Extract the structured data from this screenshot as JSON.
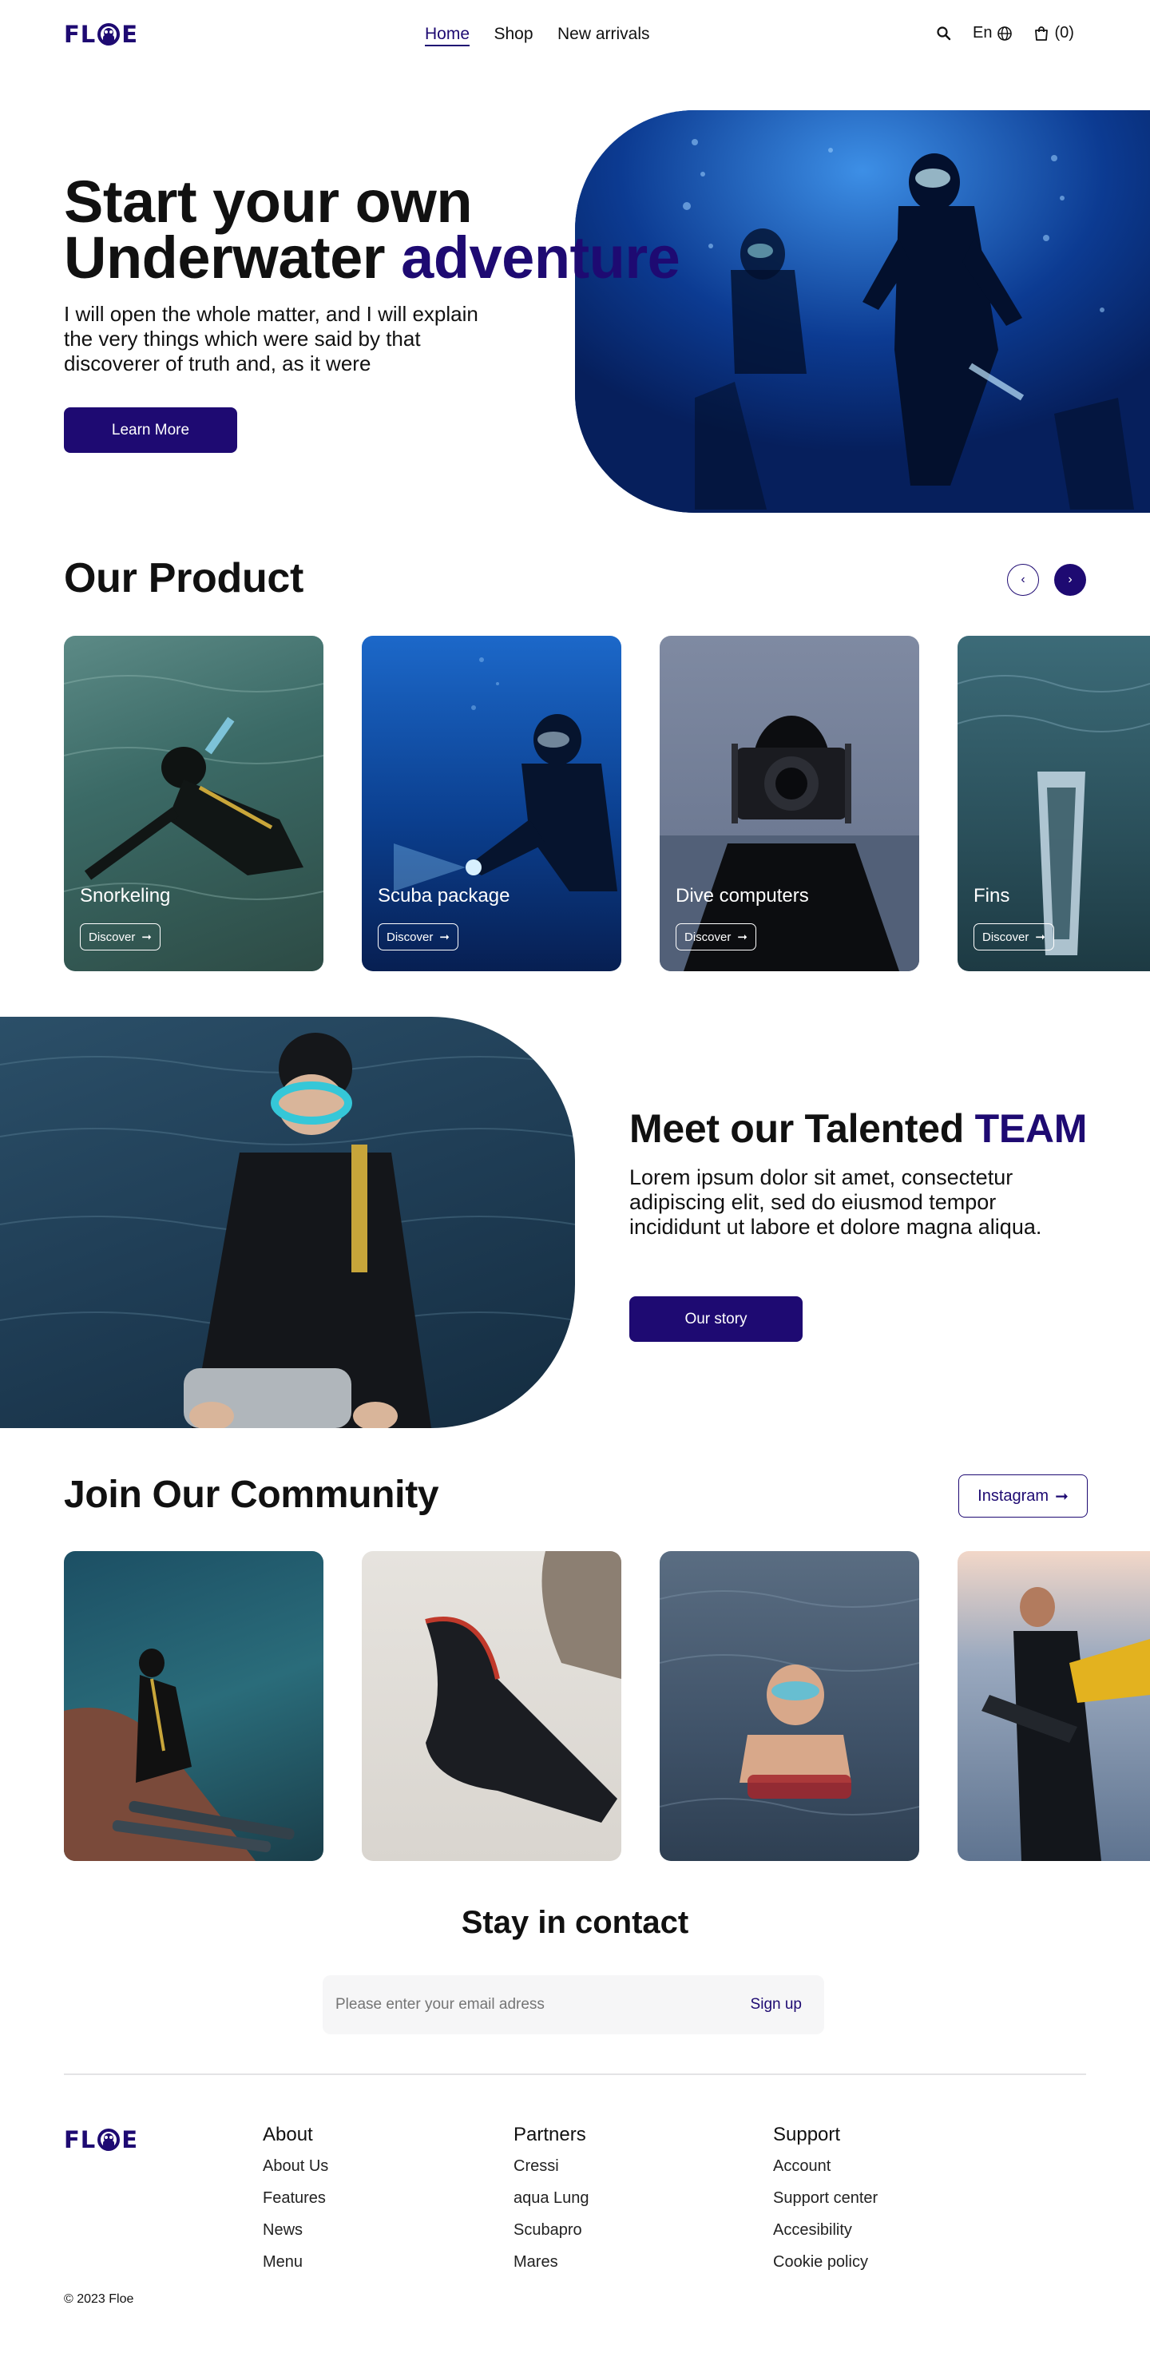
{
  "brand": {
    "name": "FLOE",
    "logo_icon": "diver-mask-logo",
    "color": "#1e0a72"
  },
  "header": {
    "nav": [
      "Home",
      "Shop",
      "New arrivals"
    ],
    "active_nav": "Home",
    "search_icon": "search-icon",
    "language": "En",
    "language_icon": "globe-icon",
    "cart_icon": "shopping-bag-icon",
    "cart_count": "(0)"
  },
  "hero": {
    "title_line1": "Start your own",
    "title_line2_plain": "Underwater",
    "title_line2_accent": "adventure",
    "description": "I will open the whole matter, and I will explain the very things which were said by that discoverer of truth and, as it were",
    "cta": "Learn More"
  },
  "products": {
    "title": "Our Product",
    "prev_icon": "chevron-left-icon",
    "next_icon": "chevron-right-icon",
    "items": [
      {
        "name": "Snorkeling",
        "cta": "Discover"
      },
      {
        "name": "Scuba package",
        "cta": "Discover"
      },
      {
        "name": "Dive computers",
        "cta": "Discover"
      },
      {
        "name": "Fins",
        "cta": "Discover"
      }
    ]
  },
  "team": {
    "title_plain": "Meet our Talented",
    "title_accent": "TEAM",
    "description": "Lorem ipsum dolor sit amet, consectetur adipiscing elit, sed do eiusmod tempor incididunt ut labore et dolore magna aliqua.",
    "cta": "Our story"
  },
  "community": {
    "title": "Join Our Community",
    "cta": "Instagram",
    "cta_icon": "arrow-right-icon"
  },
  "contact": {
    "title": "Stay in contact",
    "email_placeholder": "Please enter your email adress",
    "signup": "Sign up"
  },
  "footer": {
    "columns": [
      {
        "title": "About",
        "links": [
          "About Us",
          "Features",
          "News",
          "Menu"
        ]
      },
      {
        "title": "Partners",
        "links": [
          "Cressi",
          "aqua Lung",
          "Scubapro",
          "Mares"
        ]
      },
      {
        "title": "Support",
        "links": [
          "Account",
          "Support center",
          "Accesibility",
          "Cookie policy"
        ]
      }
    ],
    "copyright": "© 2023",
    "copyright_name": "Floe"
  }
}
